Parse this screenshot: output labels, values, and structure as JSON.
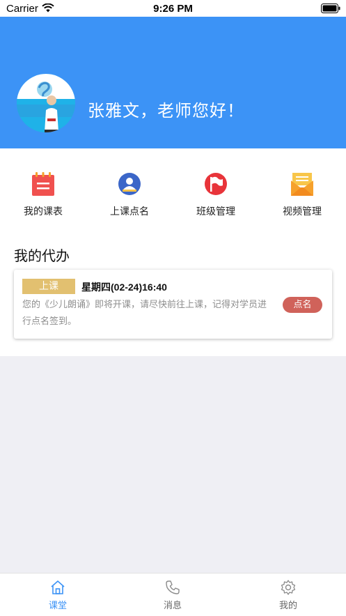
{
  "status_bar": {
    "carrier": "Carrier",
    "time": "9:26 PM"
  },
  "header": {
    "greeting": "张雅文，老师您好！",
    "background_color": "#3C93F6"
  },
  "shortcuts": [
    {
      "label": "我的课表",
      "icon": "calendar-icon",
      "color": "#F0514F"
    },
    {
      "label": "上课点名",
      "icon": "user-card-icon",
      "color": "#3B66C8"
    },
    {
      "label": "班级管理",
      "icon": "flag-icon",
      "color": "#E8343A"
    },
    {
      "label": "视频管理",
      "icon": "mail-icon",
      "color": "#F6A12C"
    }
  ],
  "todo": {
    "title": "我的代办",
    "items": [
      {
        "tag": "上课",
        "datetime": "星期四(02-24)16:40",
        "description": "您的《少儿朗诵》即将开课，请尽快前往上课，记得对学员进行点名签到。",
        "action": "点名"
      }
    ]
  },
  "tabbar": {
    "active": "课堂",
    "accent": "#3C93F6",
    "tabs": [
      {
        "label": "课堂",
        "icon": "home-icon"
      },
      {
        "label": "消息",
        "icon": "phone-icon"
      },
      {
        "label": "我的",
        "icon": "gear-icon"
      }
    ]
  }
}
